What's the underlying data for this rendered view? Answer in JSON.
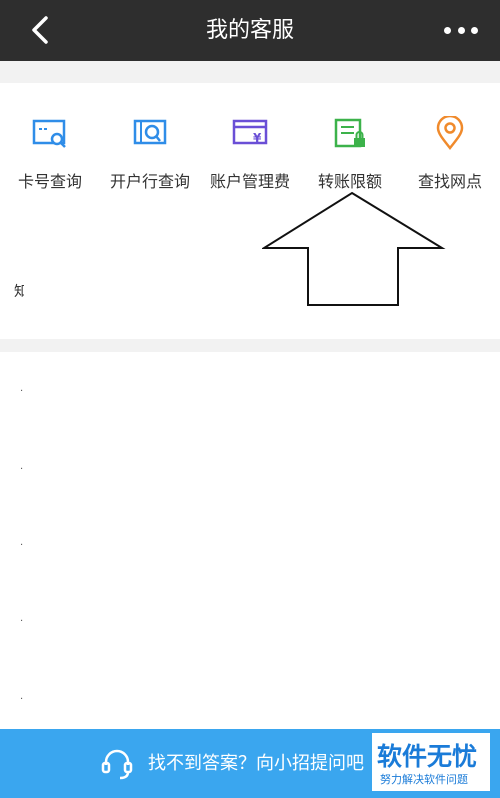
{
  "header": {
    "title": "我的客服"
  },
  "quick_actions": [
    {
      "label": "卡号查询",
      "icon": "card-search-icon",
      "color": "#2f8de8"
    },
    {
      "label": "开户行查询",
      "icon": "bank-search-icon",
      "color": "#2f8de8"
    },
    {
      "label": "账户管理费",
      "icon": "account-fee-icon",
      "color": "#6a4fd6"
    },
    {
      "label": "转账限额",
      "icon": "transfer-limit-icon",
      "color": "#3cb24a"
    },
    {
      "label": "查找网点",
      "icon": "location-pin-icon",
      "color": "#f08a2c"
    }
  ],
  "card1": {
    "partial_text": "知"
  },
  "footer": {
    "text": "找不到答案？向小招提问吧",
    "icon": "headset-icon",
    "background": "#3aa6ef"
  },
  "watermark": {
    "line1": "软件无忧",
    "line2": "努力解决软件问题"
  }
}
